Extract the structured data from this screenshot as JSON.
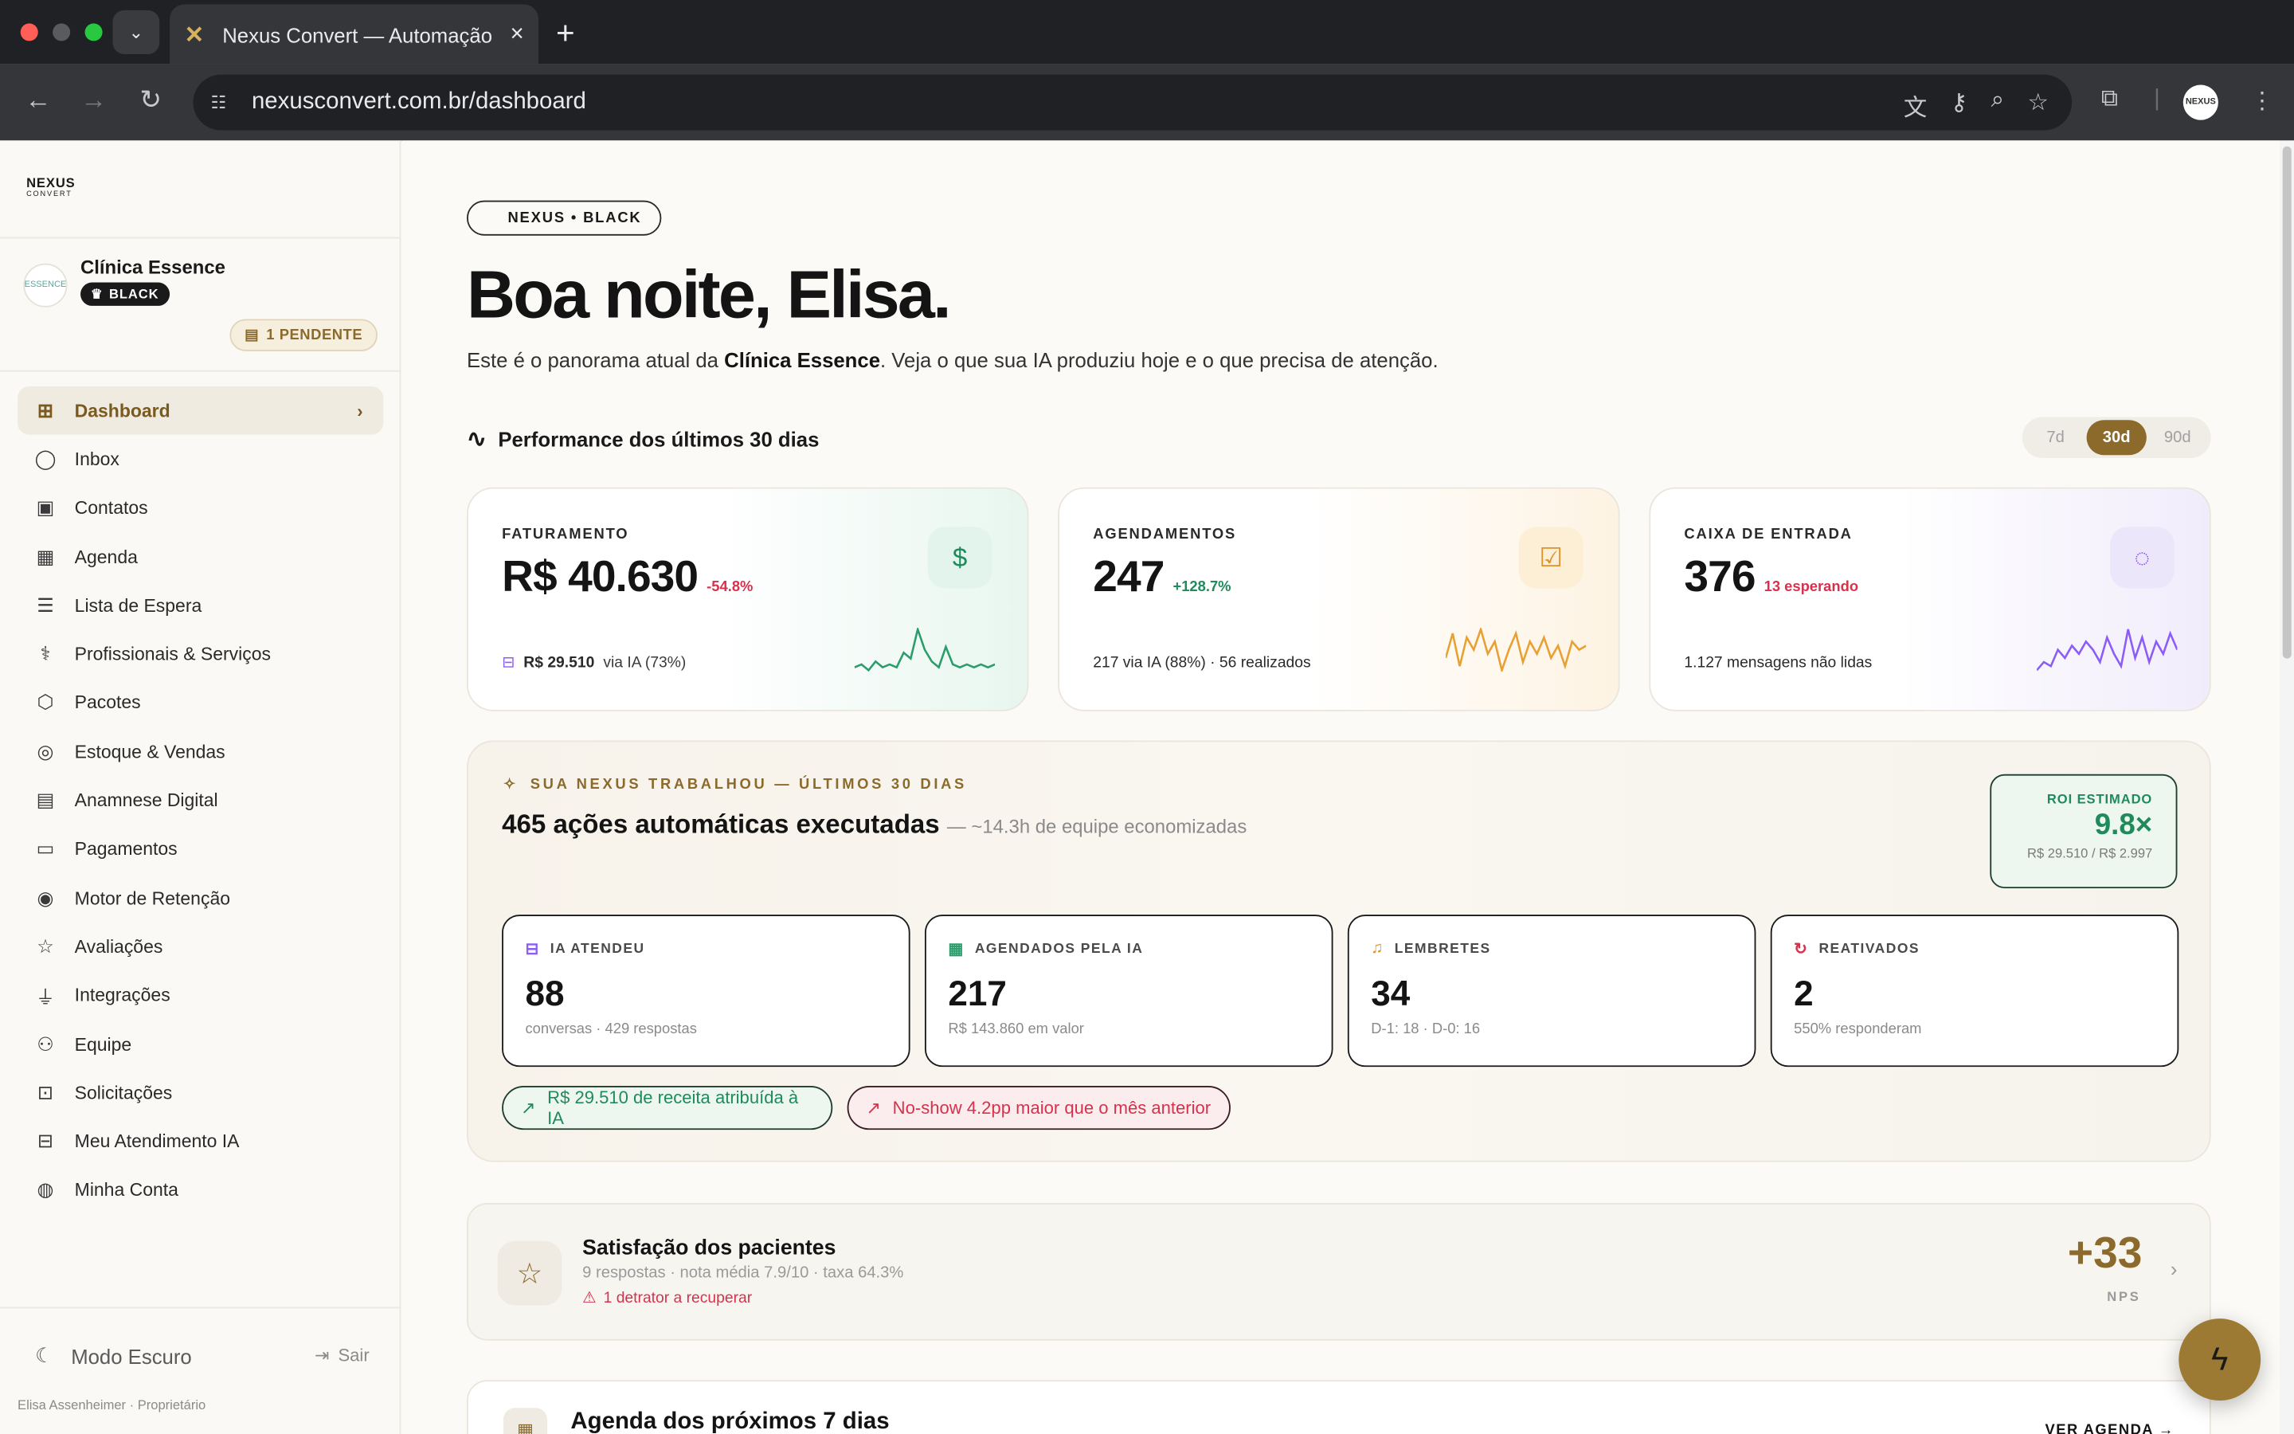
{
  "browser": {
    "tab_title": "Nexus Convert — Automação",
    "url": "nexusconvert.com.br/dashboard",
    "profile_initials": "NEXUS"
  },
  "sidebar": {
    "logo_main": "NEXUS",
    "logo_sub": "CONVERT",
    "clinic_name": "Clínica Essence",
    "clinic_avatar_text": "ESSENCE",
    "plan_badge": "BLACK",
    "pending": "1 PENDENTE",
    "items": [
      {
        "label": "Dashboard",
        "icon": "grid-icon"
      },
      {
        "label": "Inbox",
        "icon": "chat-icon"
      },
      {
        "label": "Contatos",
        "icon": "contact-icon"
      },
      {
        "label": "Agenda",
        "icon": "calendar-icon"
      },
      {
        "label": "Lista de Espera",
        "icon": "list-icon"
      },
      {
        "label": "Profissionais & Serviços",
        "icon": "stethoscope-icon"
      },
      {
        "label": "Pacotes",
        "icon": "package-icon"
      },
      {
        "label": "Estoque & Vendas",
        "icon": "store-icon"
      },
      {
        "label": "Anamnese Digital",
        "icon": "clipboard-icon"
      },
      {
        "label": "Pagamentos",
        "icon": "card-icon"
      },
      {
        "label": "Motor de Retenção",
        "icon": "target-icon"
      },
      {
        "label": "Avaliações",
        "icon": "star-icon"
      },
      {
        "label": "Integrações",
        "icon": "plug-icon"
      },
      {
        "label": "Equipe",
        "icon": "team-icon"
      },
      {
        "label": "Solicitações",
        "icon": "request-icon"
      },
      {
        "label": "Meu Atendimento IA",
        "icon": "bot-icon"
      },
      {
        "label": "Minha Conta",
        "icon": "user-icon"
      }
    ],
    "dark_mode": "Modo Escuro",
    "logout": "Sair",
    "owner": "Elisa Assenheimer · Proprietário"
  },
  "header": {
    "plan_pill": "NEXUS • BLACK",
    "greeting": "Boa noite, Elisa.",
    "sub_before": "Este é o panorama atual da ",
    "sub_bold": "Clínica Essence",
    "sub_after": ". Veja o que sua IA produziu hoje e o que precisa de atenção."
  },
  "performance": {
    "title": "Performance dos últimos 30 dias",
    "ranges": [
      "7d",
      "30d",
      "90d"
    ],
    "selected_range": "30d"
  },
  "kpis": [
    {
      "label": "FATURAMENTO",
      "value": "R$ 40.630",
      "delta": "-54.8%",
      "delta_color": "#d6324d",
      "icon": "dollar-icon",
      "foot_value": "R$ 29.510",
      "foot_text": "via IA (73%)",
      "spark_color": "#2a9d6b",
      "spark": [
        3,
        4,
        2,
        5,
        3,
        4,
        3,
        8,
        6,
        16,
        9,
        5,
        3,
        10,
        4,
        3,
        4,
        3,
        4,
        3,
        4
      ]
    },
    {
      "label": "AGENDAMENTOS",
      "value": "247",
      "delta": "+128.7%",
      "delta_color": "#1f8a5b",
      "icon": "calendar-check-icon",
      "foot_value": "217 via IA (88%) · 56 realizados",
      "foot_text": "",
      "spark_color": "#e8a032",
      "spark": [
        8,
        14,
        6,
        13,
        10,
        15,
        9,
        12,
        5,
        10,
        14,
        7,
        12,
        9,
        13,
        8,
        11,
        6,
        12,
        10,
        11
      ]
    },
    {
      "label": "CAIXA DE ENTRADA",
      "value": "376",
      "delta": "13 esperando",
      "delta_color": "#d6324d",
      "icon": "message-icon",
      "foot_value": "1.127 mensagens não lidas",
      "foot_text": "",
      "spark_color": "#8b5cf6",
      "spark": [
        4,
        6,
        5,
        9,
        7,
        10,
        8,
        11,
        9,
        6,
        12,
        8,
        5,
        14,
        7,
        12,
        6,
        11,
        8,
        13,
        9
      ]
    }
  ],
  "nexus": {
    "kicker": "SUA NEXUS TRABALHOU — ÚLTIMOS 30 DIAS",
    "title": "465 ações automáticas executadas",
    "title_secondary": "— ~14.3h de equipe economizadas",
    "roi_label": "ROI ESTIMADO",
    "roi_value": "9.8×",
    "roi_detail": "R$ 29.510 / R$ 2.997",
    "stats": [
      {
        "label": "IA ATENDEU",
        "value": "88",
        "sub": "conversas · 429 respostas",
        "icon": "bot-icon"
      },
      {
        "label": "AGENDADOS PELA IA",
        "value": "217",
        "sub": "R$ 143.860 em valor",
        "icon": "calendar-icon"
      },
      {
        "label": "LEMBRETES",
        "value": "34",
        "sub": "D-1: 18 · D-0: 16",
        "icon": "bell-icon"
      },
      {
        "label": "REATIVADOS",
        "value": "2",
        "sub": "550% responderam",
        "icon": "refresh-icon"
      }
    ],
    "chip_positive": "R$ 29.510 de receita atribuída à IA",
    "chip_negative": "No-show 4.2pp maior que o mês anterior"
  },
  "nps": {
    "title": "Satisfação dos pacientes",
    "meta": "9 respostas · nota média 7.9/10 · taxa 64.3%",
    "detractor": "1 detrator a recuperar",
    "value": "+33",
    "label": "NPS"
  },
  "agenda": {
    "title": "Agenda dos próximos 7 dias",
    "link": "VER AGENDA →"
  }
}
